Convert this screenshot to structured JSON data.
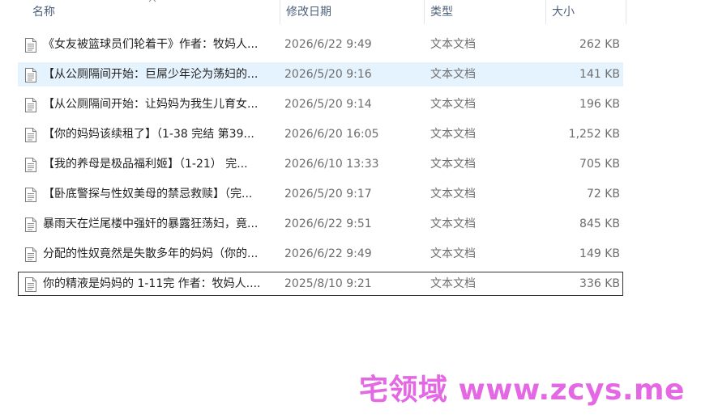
{
  "columns": {
    "name": "名称",
    "date": "修改日期",
    "type": "类型",
    "size": "大小"
  },
  "files": [
    {
      "name": "《女友被篮球员们轮着干》作者：牧妈人...",
      "date": "2026/6/22 9:49",
      "type": "文本文档",
      "size": "262 KB",
      "icon": "text-file-icon"
    },
    {
      "name": "【从公厕隔间开始：巨屌少年沦为荡妇的...",
      "date": "2026/5/20 9:16",
      "type": "文本文档",
      "size": "141 KB",
      "icon": "text-file-icon"
    },
    {
      "name": "【从公厕隔间开始：让妈妈为我生儿育女...",
      "date": "2026/5/20 9:14",
      "type": "文本文档",
      "size": "196 KB",
      "icon": "text-file-icon"
    },
    {
      "name": "【你的妈妈该续租了】（1-38 完结 第39...",
      "date": "2026/6/20 16:05",
      "type": "文本文档",
      "size": "1,252 KB",
      "icon": "text-file-icon"
    },
    {
      "name": "【我的养母是极品福利姬】（1-21） 完...",
      "date": "2026/6/10 13:33",
      "type": "文本文档",
      "size": "705 KB",
      "icon": "text-file-icon"
    },
    {
      "name": "【卧底警探与性奴美母的禁忌救赎】（完...",
      "date": "2026/5/20 9:17",
      "type": "文本文档",
      "size": "72 KB",
      "icon": "text-file-icon"
    },
    {
      "name": "暴雨天在烂尾楼中强奸的暴露狂荡妇，竟...",
      "date": "2026/6/22 9:51",
      "type": "文本文档",
      "size": "845 KB",
      "icon": "text-file-icon"
    },
    {
      "name": "分配的性奴竟然是失散多年的妈妈（你的...",
      "date": "2026/6/22 9:49",
      "type": "文本文档",
      "size": "149 KB",
      "icon": "text-file-icon"
    },
    {
      "name": "你的精液是妈妈的 1-11完 作者：牧妈人....",
      "date": "2025/8/10 9:21",
      "type": "文本文档",
      "size": "336 KB",
      "icon": "text-file-icon"
    }
  ],
  "selected_index": 1,
  "focused_index": 8,
  "watermark": "宅领域 www.zcys.me",
  "colors": {
    "selected_bg": "#e5f3ff",
    "header_text": "#4c607a",
    "watermark": "#e468e4"
  }
}
